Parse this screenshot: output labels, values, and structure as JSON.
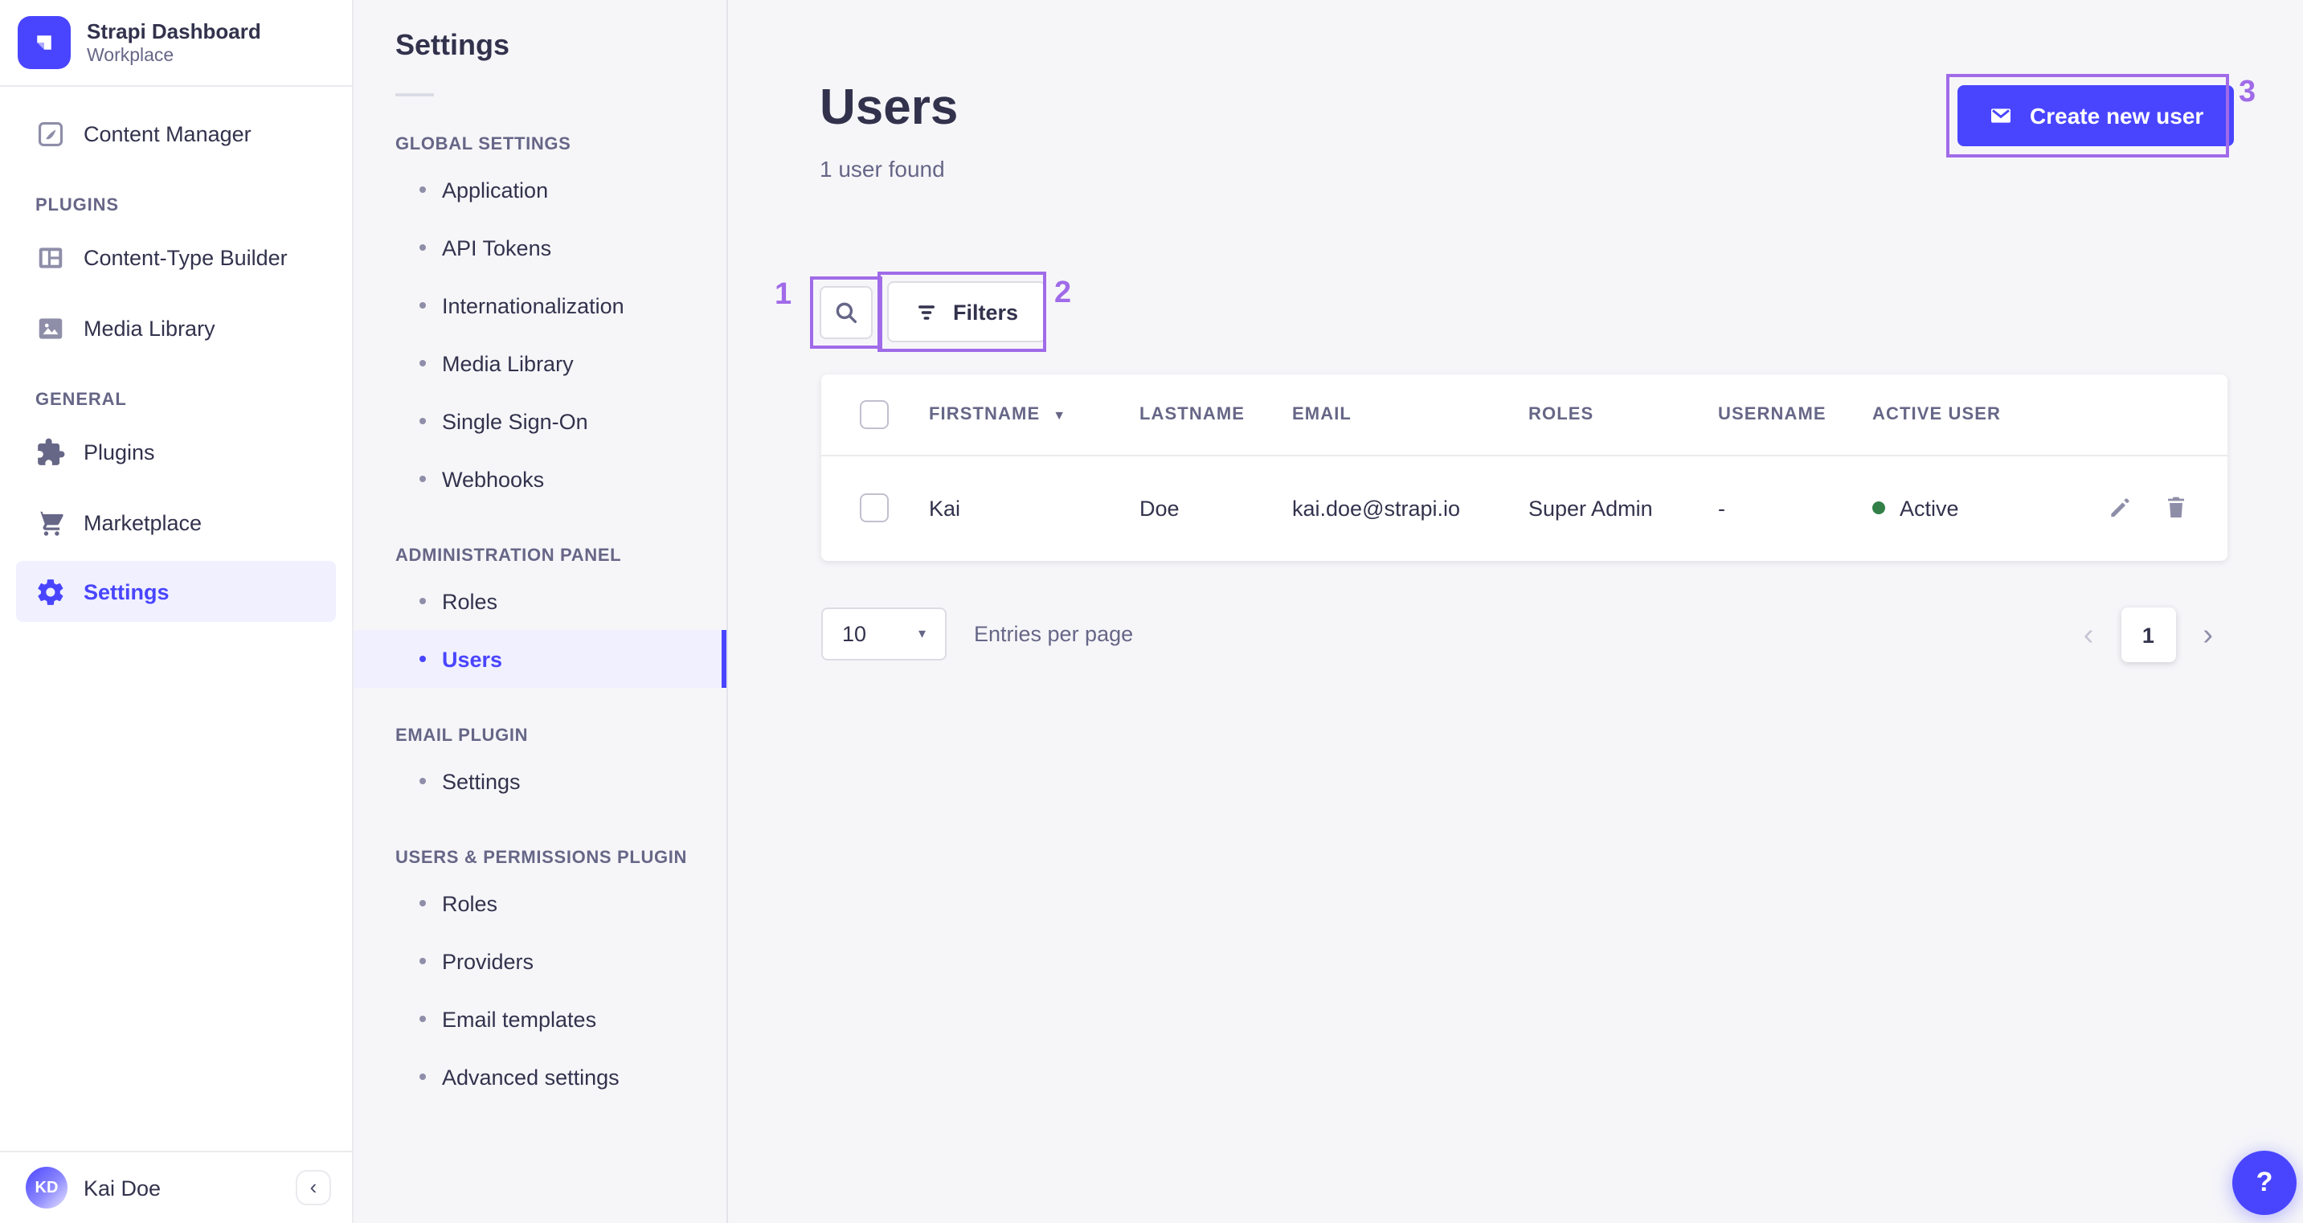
{
  "app": {
    "name": "Strapi Dashboard",
    "workspace": "Workplace"
  },
  "colors": {
    "primary": "#4945ff",
    "primary_light": "#f0f0ff",
    "annotation": "#a06be8",
    "success_dot": "#328048",
    "text": "#32324d",
    "text_muted": "#666687",
    "background": "#f6f6f9"
  },
  "sidebar": {
    "content_manager": {
      "label": "Content Manager",
      "icon": "feather-icon"
    },
    "sections": [
      {
        "title": "PLUGINS",
        "items": [
          {
            "label": "Content-Type Builder",
            "icon": "layout-icon"
          },
          {
            "label": "Media Library",
            "icon": "image-icon"
          }
        ]
      },
      {
        "title": "GENERAL",
        "items": [
          {
            "label": "Plugins",
            "icon": "puzzle-icon"
          },
          {
            "label": "Marketplace",
            "icon": "cart-icon"
          },
          {
            "label": "Settings",
            "icon": "gear-icon",
            "active": true
          }
        ]
      }
    ],
    "footer": {
      "user_name": "Kai Doe",
      "user_initials": "KD",
      "collapse_icon": "‹"
    }
  },
  "subnav": {
    "title": "Settings",
    "sections": [
      {
        "title": "GLOBAL SETTINGS",
        "items": [
          {
            "label": "Application"
          },
          {
            "label": "API Tokens"
          },
          {
            "label": "Internationalization"
          },
          {
            "label": "Media Library"
          },
          {
            "label": "Single Sign-On"
          },
          {
            "label": "Webhooks"
          }
        ]
      },
      {
        "title": "ADMINISTRATION PANEL",
        "items": [
          {
            "label": "Roles"
          },
          {
            "label": "Users",
            "active": true
          }
        ]
      },
      {
        "title": "EMAIL PLUGIN",
        "items": [
          {
            "label": "Settings"
          }
        ]
      },
      {
        "title": "USERS & PERMISSIONS PLUGIN",
        "items": [
          {
            "label": "Roles"
          },
          {
            "label": "Providers"
          },
          {
            "label": "Email templates"
          },
          {
            "label": "Advanced settings"
          }
        ]
      }
    ]
  },
  "main": {
    "title": "Users",
    "subtitle": "1 user found",
    "create_button_label": "Create new user",
    "filters_button_label": "Filters",
    "icons": {
      "sort_caret": "▼",
      "select_caret": "▾"
    },
    "table": {
      "columns": [
        "FIRSTNAME",
        "LASTNAME",
        "EMAIL",
        "ROLES",
        "USERNAME",
        "ACTIVE USER"
      ],
      "sorted_by": "FIRSTNAME",
      "rows": [
        {
          "firstname": "Kai",
          "lastname": "Doe",
          "email": "kai.doe@strapi.io",
          "roles": "Super Admin",
          "username": "-",
          "status": "Active"
        }
      ]
    },
    "pagination": {
      "entries_value": "10",
      "entries_label": "Entries per page",
      "page": "1",
      "prev_icon": "‹",
      "next_icon": "›"
    }
  },
  "help_button_label": "?",
  "annotations": [
    {
      "id": "1",
      "target": "search-button"
    },
    {
      "id": "2",
      "target": "filters-button"
    },
    {
      "id": "3",
      "target": "create-new-user-button"
    }
  ]
}
